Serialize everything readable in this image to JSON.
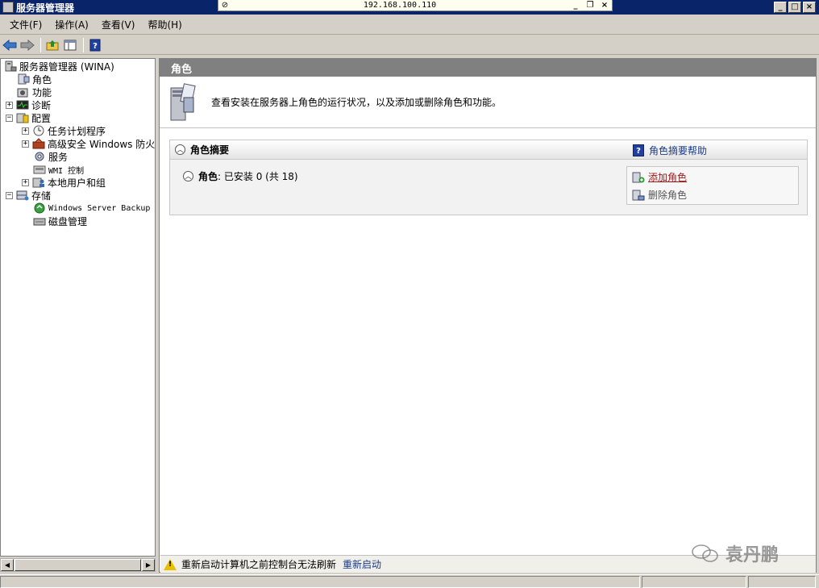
{
  "window": {
    "title": "服务器管理器",
    "rdp_host": "192.168.100.110"
  },
  "menu": [
    "文件(F)",
    "操作(A)",
    "查看(V)",
    "帮助(H)"
  ],
  "tree": {
    "root": "服务器管理器 (WINA)",
    "roles": "角色",
    "features": "功能",
    "diagnostics": "诊断",
    "configuration": "配置",
    "task_scheduler": "任务计划程序",
    "firewall": "高级安全 Windows 防火墙",
    "services": "服务",
    "wmi": "WMI 控制",
    "local_users": "本地用户和组",
    "storage": "存储",
    "backup": "Windows Server Backup",
    "disk": "磁盘管理"
  },
  "main": {
    "header": "角色",
    "intro": "查看安装在服务器上角色的运行状况，以及添加或删除角色和功能。",
    "section_title": "角色摘要",
    "help_link": "角色摘要帮助",
    "roles_label": "角色",
    "roles_status": ": 已安装 0 (共 18)",
    "add_roles": "添加角色",
    "remove_roles": "删除角色"
  },
  "warning": {
    "text": "重新启动计算机之前控制台无法刷新",
    "link": "重新启动"
  },
  "watermark": "袁丹鹏",
  "colors": {
    "titlebar": "#0a246a",
    "link": "#1a3a8a",
    "add_link": "#9a1c1c",
    "header_bg": "#808080"
  }
}
